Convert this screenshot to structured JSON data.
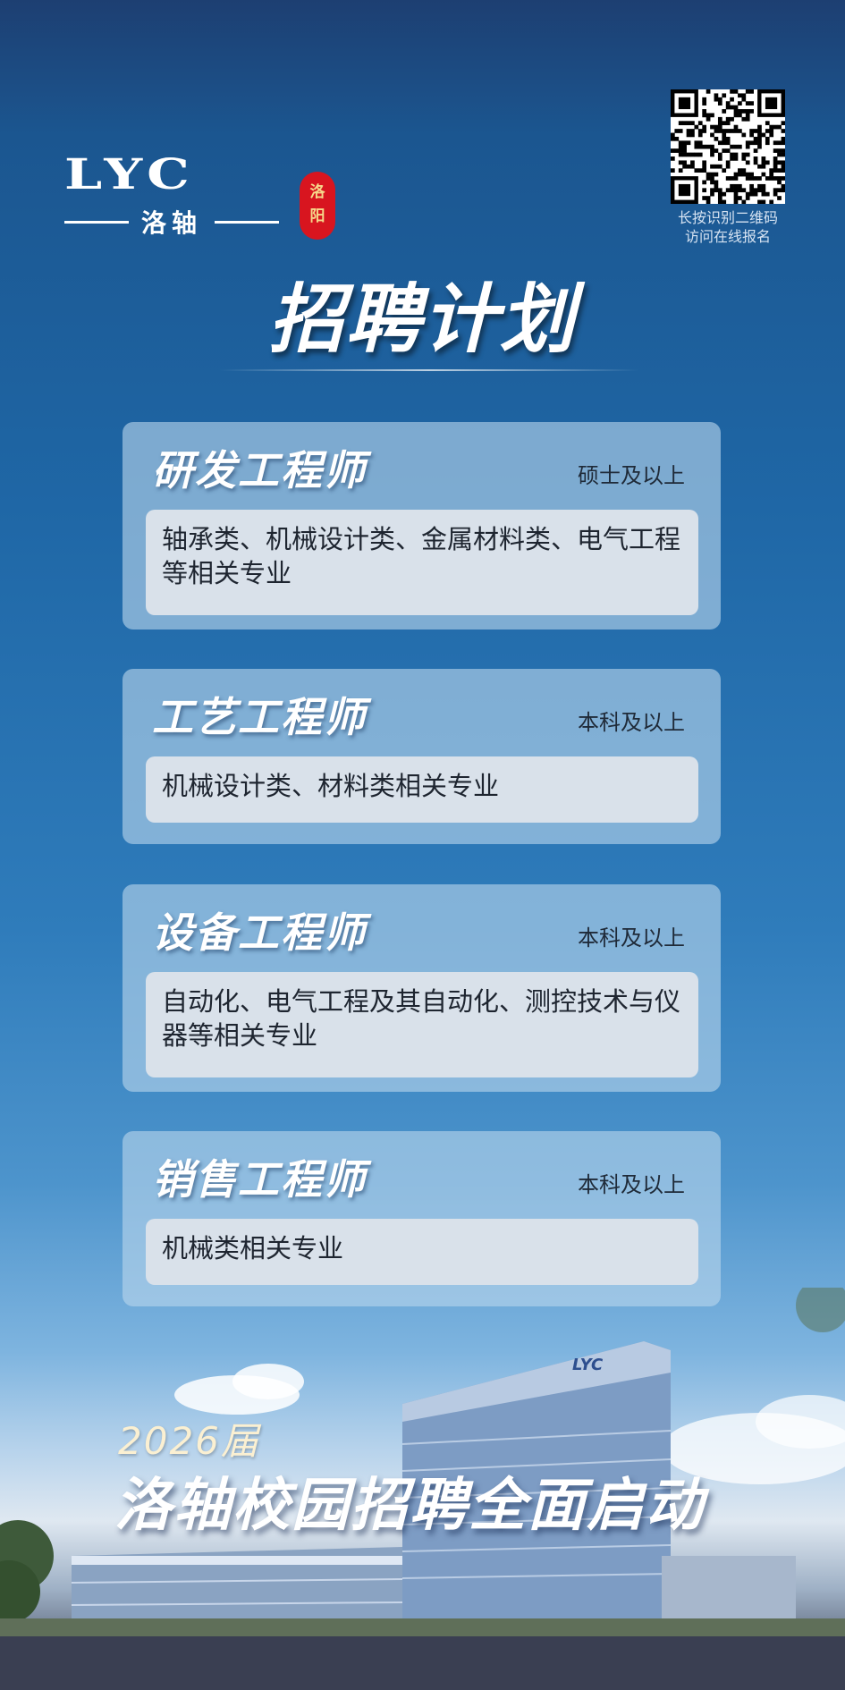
{
  "brand": {
    "logo_text": "LYC",
    "logo_subtext": "洛轴",
    "seal_text_1": "洛",
    "seal_text_2": "阳"
  },
  "qr": {
    "icon": "qr-code-icon",
    "caption_line1": "长按识别二维码",
    "caption_line2": "访问在线报名"
  },
  "title": "招聘计划",
  "positions": [
    {
      "title": "研发工程师",
      "degree": "硕士及以上",
      "majors": "轴承类、机械设计类、金属材料类、电气工程等相关专业"
    },
    {
      "title": "工艺工程师",
      "degree": "本科及以上",
      "majors": "机械设计类、材料类相关专业"
    },
    {
      "title": "设备工程师",
      "degree": "本科及以上",
      "majors": "自动化、电气工程及其自动化、测控技术与仪器等相关专业"
    },
    {
      "title": "销售工程师",
      "degree": "本科及以上",
      "majors": "机械类相关专业"
    }
  ],
  "footer": {
    "year": "2026届",
    "slogan": "洛轴校园招聘全面启动",
    "building_sign": "LYC"
  },
  "colors": {
    "seal": "#d8151f",
    "card": "#b8d5ec",
    "card_body": "#d9e1ea"
  }
}
